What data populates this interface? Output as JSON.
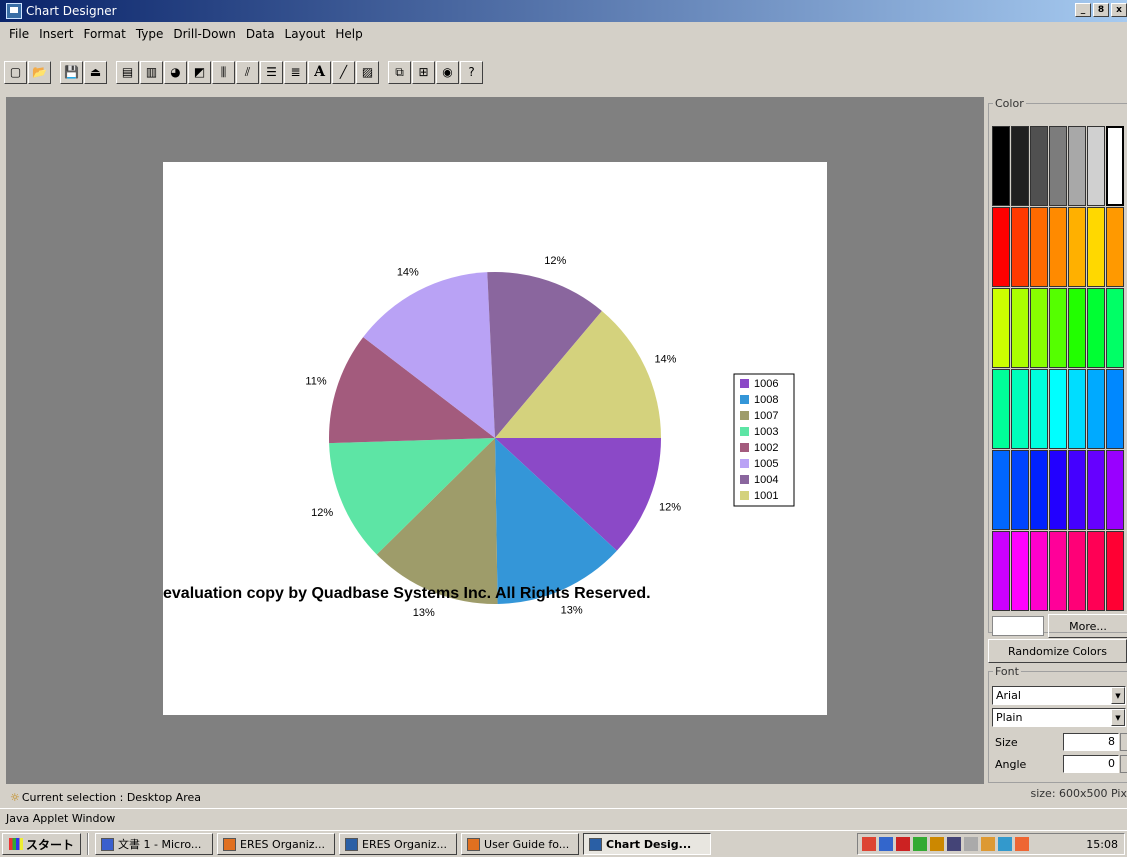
{
  "window": {
    "title": "Chart Designer",
    "controls": [
      "_",
      "8",
      "x"
    ]
  },
  "menu": [
    "File",
    "Insert",
    "Format",
    "Type",
    "Drill-Down",
    "Data",
    "Layout",
    "Help"
  ],
  "toolbar": {
    "groups": [
      [
        {
          "name": "new-icon",
          "glyph": "▢"
        },
        {
          "name": "open-icon",
          "glyph": "📂"
        }
      ],
      [
        {
          "name": "save-icon",
          "glyph": "💾"
        },
        {
          "name": "export-icon",
          "glyph": "⏏"
        }
      ],
      [
        {
          "name": "chart-type-icon",
          "glyph": "▤"
        },
        {
          "name": "bar-chart-icon",
          "glyph": "▥"
        },
        {
          "name": "pie-chart-icon",
          "glyph": "◕"
        },
        {
          "name": "area-chart-icon",
          "glyph": "◩"
        },
        {
          "name": "axis-scale-icon",
          "glyph": "⫼"
        },
        {
          "name": "axis-label-icon",
          "glyph": "⫽"
        },
        {
          "name": "legend-icon",
          "glyph": "☰"
        },
        {
          "name": "list-icon",
          "glyph": "≣"
        },
        {
          "name": "text-tool-icon",
          "glyph": "A",
          "bold": true
        },
        {
          "name": "line-tool-icon",
          "glyph": "╱"
        },
        {
          "name": "image-tool-icon",
          "glyph": "▨"
        }
      ],
      [
        {
          "name": "copy-icon",
          "glyph": "⧉"
        },
        {
          "name": "paste-icon",
          "glyph": "⊞"
        },
        {
          "name": "chart-3d-icon",
          "glyph": "◉"
        },
        {
          "name": "help-icon",
          "glyph": "?"
        }
      ]
    ]
  },
  "chart_data": {
    "type": "pie",
    "categories": [
      "1006",
      "1008",
      "1007",
      "1003",
      "1002",
      "1005",
      "1004",
      "1001"
    ],
    "values": [
      12,
      13,
      13,
      12,
      11,
      14,
      12,
      14
    ],
    "labels": [
      "12%",
      "13%",
      "13%",
      "12%",
      "11%",
      "14%",
      "12%",
      "14%"
    ],
    "colors": [
      "#8b49c7",
      "#3496d8",
      "#9e9c6a",
      "#5de5a5",
      "#a35b7d",
      "#b9a2f5",
      "#8a669e",
      "#d4d27d"
    ],
    "legend_position": "right",
    "watermark": "evaluation copy by Quadbase Systems Inc. All Rights Reserved."
  },
  "panel": {
    "color_label": "Color",
    "swatches": [
      "#000000",
      "#202020",
      "#505050",
      "#7c7c7c",
      "#a8a8a8",
      "#d0d0d0",
      "#ffffff",
      "#ff0000",
      "#ff3a00",
      "#ff6a00",
      "#ff8a00",
      "#ffb000",
      "#ffd800",
      "#ff9900",
      "#ccff00",
      "#aaff00",
      "#88ff00",
      "#55ff00",
      "#22ff00",
      "#00ff33",
      "#00ff66",
      "#00ff99",
      "#00ffbb",
      "#00ffdd",
      "#00ffff",
      "#00ddff",
      "#00aaff",
      "#0088ff",
      "#0066ff",
      "#0044ff",
      "#0022ff",
      "#2200ff",
      "#4400ff",
      "#6600ff",
      "#9900ff",
      "#cc00ff",
      "#ff00ff",
      "#ff00cc",
      "#ff0099",
      "#ff0077",
      "#ff0055",
      "#ff0033"
    ],
    "more_label": "More...",
    "randomize_label": "Randomize Colors",
    "font_label": "Font",
    "font_family": "Arial",
    "font_style": "Plain",
    "size_label": "Size",
    "size_value": "8",
    "angle_label": "Angle",
    "angle_value": "0"
  },
  "status": {
    "selection": "Current selection : Desktop Area",
    "size_info": "size: 600x500 Pix",
    "applet": "Java Applet Window"
  },
  "taskbar": {
    "start_label": "スタート",
    "tasks": [
      {
        "label": "文書 1 - Micro...",
        "color": "#3a5fcd",
        "active": false
      },
      {
        "label": "ERES Organiz...",
        "color": "#e07020",
        "active": false
      },
      {
        "label": "ERES Organiz...",
        "color": "#2a5fa5",
        "active": false
      },
      {
        "label": "User Guide fo...",
        "color": "#e07020",
        "active": false
      },
      {
        "label": "Chart Desig...",
        "color": "#2a5fa5",
        "active": true
      }
    ],
    "tray_colors": [
      "#d43",
      "#36c",
      "#c22",
      "#3a3",
      "#c80",
      "#447",
      "#aaa",
      "#d93",
      "#39c",
      "#e63"
    ],
    "clock": "15:08"
  }
}
